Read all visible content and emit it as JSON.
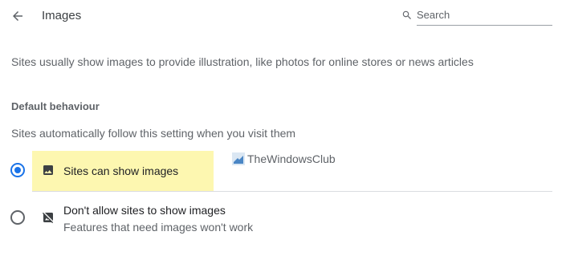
{
  "header": {
    "title": "Images",
    "back_icon": "arrow-back-icon",
    "search": {
      "placeholder": "Search",
      "icon": "search-icon"
    }
  },
  "description": "Sites usually show images to provide illustration, like photos for online stores or news articles",
  "default_behaviour": {
    "heading": "Default behaviour",
    "subtitle": "Sites automatically follow this setting when you visit them",
    "options": [
      {
        "label": "Sites can show images",
        "sublabel": "",
        "icon": "image-icon",
        "selected": true
      },
      {
        "label": "Don't allow sites to show images",
        "sublabel": "Features that need images won't work",
        "icon": "image-blocked-icon",
        "selected": false
      }
    ]
  },
  "watermark": {
    "text": "TheWindowsClub",
    "icon": "windows-club-logo"
  },
  "colors": {
    "accent": "#1a73e8",
    "highlight": "#fdf7b0",
    "text_primary": "#202124",
    "text_secondary": "#5f6368",
    "divider": "#dadce0"
  }
}
